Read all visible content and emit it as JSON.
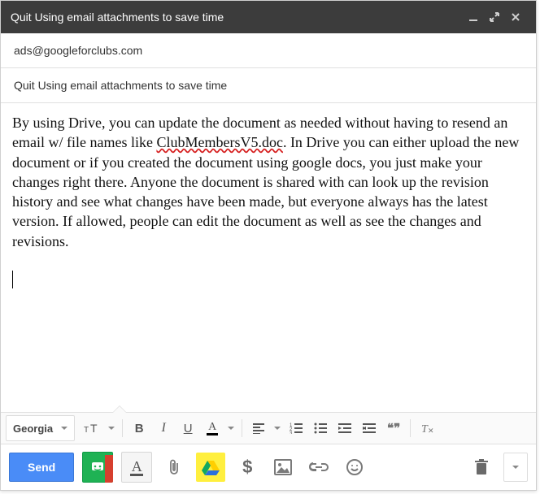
{
  "window": {
    "title": "Quit Using email attachments to save time"
  },
  "to": {
    "value": "ads@googleforclubs.com"
  },
  "subject": {
    "value": "Quit Using email attachments to save time"
  },
  "body": {
    "pre": "By using Drive, you can update the document as needed without having to resend an email w/ file names like ",
    "misspelled": "ClubMembersV5.doc",
    "post": ".  In Drive you can either upload the new document or if you created the document using google docs, you just make your changes right there.  Anyone the document is shared with can look up the revision history and see what changes have been made, but everyone always has the latest version.  If allowed, people can edit the document as well as see the changes and revisions."
  },
  "format": {
    "font": "Georgia",
    "bold": "B",
    "italic": "I",
    "underline": "U",
    "fontcolor": "A",
    "quote": "❝❞"
  },
  "send": {
    "label": "Send"
  },
  "bottom": {
    "format_A": "A",
    "dollar": "$"
  }
}
